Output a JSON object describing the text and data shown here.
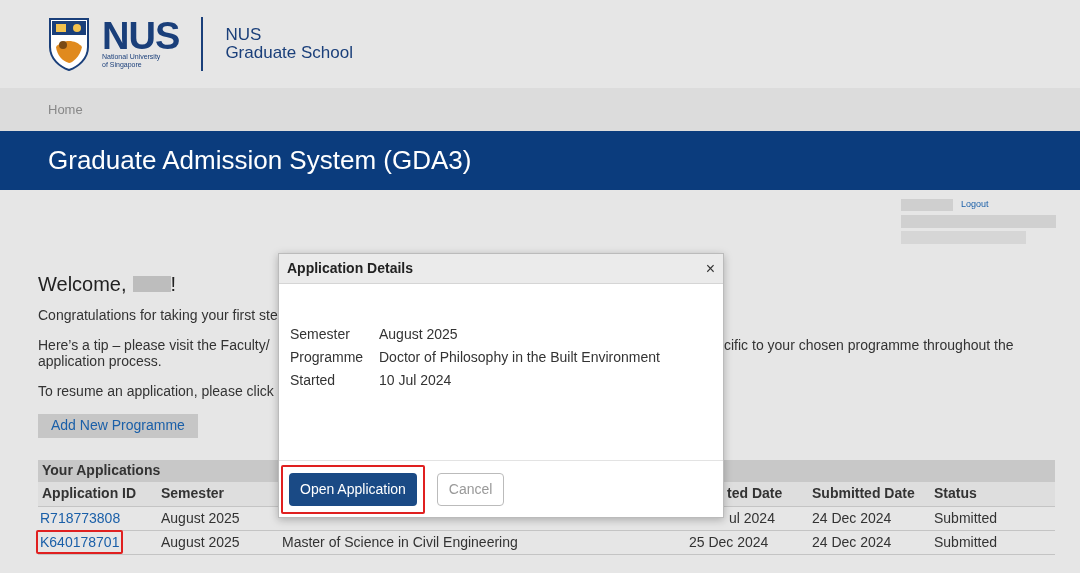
{
  "header": {
    "logo_word": "NUS",
    "logo_sub": [
      "National University",
      "of Singapore"
    ],
    "school": [
      "NUS",
      "Graduate School"
    ]
  },
  "breadcrumb": [
    "Home"
  ],
  "banner": {
    "title": "Graduate Admission System (GDA3)"
  },
  "user": {
    "logout": "Logout"
  },
  "welcome": {
    "greeting": "Welcome,",
    "suffix": "!"
  },
  "paragraphs": [
    {
      "left": "Congratulations for taking your first ste"
    },
    {
      "left": "Here’s a tip – please visit the Faculty/",
      "right": "cific to your chosen programme throughout the",
      "continuation": "application process."
    },
    {
      "left": "To resume an application, please click"
    }
  ],
  "add_button": "Add New Programme",
  "applications": {
    "title": "Your Applications",
    "columns": [
      "Application ID",
      "Semester",
      "",
      "ted Date",
      "Submitted Date",
      "Status"
    ],
    "rows": [
      {
        "id": "R718773808",
        "semester": "August 2025",
        "programme": "",
        "started": "ul 2024",
        "submitted": "24 Dec 2024",
        "status": "Submitted",
        "highlighted": false
      },
      {
        "id": "K640178701",
        "semester": "August 2025",
        "programme": "Master of Science in Civil Engineering",
        "started": "25 Dec 2024",
        "submitted": "24 Dec 2024",
        "status": "Submitted",
        "highlighted": true
      }
    ]
  },
  "dialog": {
    "title": "Application Details",
    "close": "×",
    "fields": [
      {
        "label": "Semester",
        "value": "August 2025"
      },
      {
        "label": "Programme",
        "value": "Doctor of Philosophy in the Built Environment"
      },
      {
        "label": "Started",
        "value": "10 Jul 2024"
      }
    ],
    "buttons": [
      {
        "label": "Open Application",
        "kind": "primary",
        "highlighted": true
      },
      {
        "label": "Cancel",
        "kind": "secondary",
        "highlighted": false
      }
    ]
  }
}
